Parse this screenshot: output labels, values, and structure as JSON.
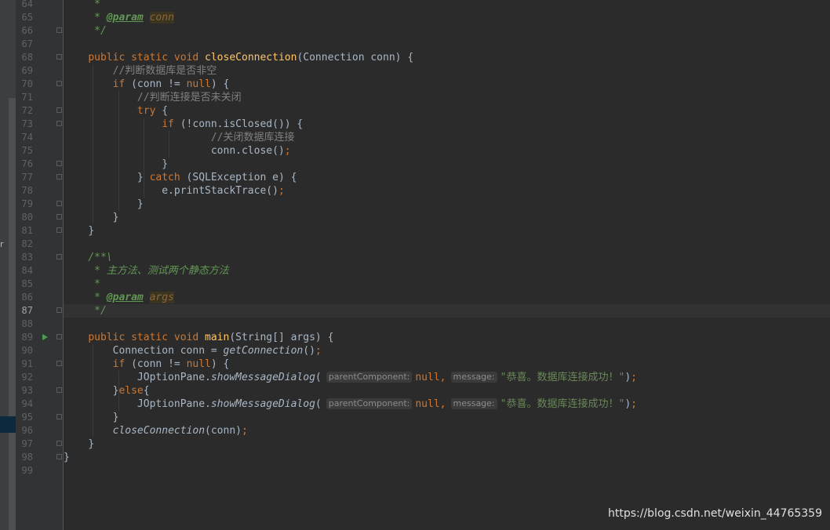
{
  "side_panel": {
    "glyph": "r"
  },
  "editor": {
    "run_gutter_line": "89",
    "current_line": "87",
    "lines": [
      {
        "num": "64",
        "fold": false,
        "segments": [
          {
            "t": "     ",
            "c": ""
          },
          {
            "t": "*",
            "c": "doc"
          }
        ]
      },
      {
        "num": "65",
        "fold": false,
        "segments": [
          {
            "t": "     ",
            "c": ""
          },
          {
            "t": "* ",
            "c": "doc"
          },
          {
            "t": "@param",
            "c": "tag"
          },
          {
            "t": " ",
            "c": "doc"
          },
          {
            "t": "conn",
            "c": "tagval"
          }
        ]
      },
      {
        "num": "66",
        "fold": true,
        "segments": [
          {
            "t": "     ",
            "c": ""
          },
          {
            "t": "*/",
            "c": "doc"
          }
        ]
      },
      {
        "num": "67",
        "fold": false,
        "segments": []
      },
      {
        "num": "68",
        "fold": true,
        "segments": [
          {
            "t": "    ",
            "c": ""
          },
          {
            "t": "public static void ",
            "c": "kw"
          },
          {
            "t": "closeConnection",
            "c": "fn"
          },
          {
            "t": "(Connection conn) {",
            "c": ""
          }
        ]
      },
      {
        "num": "69",
        "fold": false,
        "segments": [
          {
            "t": "        ",
            "c": ""
          },
          {
            "t": "//判断数据库是否非空",
            "c": "cm"
          }
        ]
      },
      {
        "num": "70",
        "fold": true,
        "segments": [
          {
            "t": "        ",
            "c": ""
          },
          {
            "t": "if ",
            "c": "kw"
          },
          {
            "t": "(conn != ",
            "c": ""
          },
          {
            "t": "null",
            "c": "kw"
          },
          {
            "t": ") {",
            "c": ""
          }
        ]
      },
      {
        "num": "71",
        "fold": false,
        "segments": [
          {
            "t": "            ",
            "c": ""
          },
          {
            "t": "//判断连接是否未关闭",
            "c": "cm"
          }
        ]
      },
      {
        "num": "72",
        "fold": true,
        "segments": [
          {
            "t": "            ",
            "c": ""
          },
          {
            "t": "try ",
            "c": "kw"
          },
          {
            "t": "{",
            "c": ""
          }
        ]
      },
      {
        "num": "73",
        "fold": true,
        "segments": [
          {
            "t": "                ",
            "c": ""
          },
          {
            "t": "if ",
            "c": "kw"
          },
          {
            "t": "(!conn.isClosed()) {",
            "c": ""
          }
        ]
      },
      {
        "num": "74",
        "fold": false,
        "segments": [
          {
            "t": "                        ",
            "c": ""
          },
          {
            "t": "//关闭数据库连接",
            "c": "cm"
          }
        ]
      },
      {
        "num": "75",
        "fold": false,
        "segments": [
          {
            "t": "                        ",
            "c": ""
          },
          {
            "t": "conn.close()",
            "c": ""
          },
          {
            "t": ";",
            "c": "kw"
          }
        ]
      },
      {
        "num": "76",
        "fold": true,
        "segments": [
          {
            "t": "                ",
            "c": ""
          },
          {
            "t": "}",
            "c": ""
          }
        ]
      },
      {
        "num": "77",
        "fold": true,
        "segments": [
          {
            "t": "            ",
            "c": ""
          },
          {
            "t": "} ",
            "c": ""
          },
          {
            "t": "catch ",
            "c": "kw"
          },
          {
            "t": "(SQLException e) {",
            "c": ""
          }
        ]
      },
      {
        "num": "78",
        "fold": false,
        "segments": [
          {
            "t": "                ",
            "c": ""
          },
          {
            "t": "e.printStackTrace()",
            "c": ""
          },
          {
            "t": ";",
            "c": "kw"
          }
        ]
      },
      {
        "num": "79",
        "fold": true,
        "segments": [
          {
            "t": "            ",
            "c": ""
          },
          {
            "t": "}",
            "c": ""
          }
        ]
      },
      {
        "num": "80",
        "fold": true,
        "segments": [
          {
            "t": "        ",
            "c": ""
          },
          {
            "t": "}",
            "c": ""
          }
        ]
      },
      {
        "num": "81",
        "fold": true,
        "segments": [
          {
            "t": "    ",
            "c": ""
          },
          {
            "t": "}",
            "c": ""
          }
        ]
      },
      {
        "num": "82",
        "fold": false,
        "segments": []
      },
      {
        "num": "83",
        "fold": true,
        "segments": [
          {
            "t": "    ",
            "c": ""
          },
          {
            "t": "/**\\",
            "c": "doc"
          }
        ]
      },
      {
        "num": "84",
        "fold": false,
        "segments": [
          {
            "t": "     ",
            "c": ""
          },
          {
            "t": "* 主方法、测试两个静态方法",
            "c": "doc"
          }
        ]
      },
      {
        "num": "85",
        "fold": false,
        "segments": [
          {
            "t": "     ",
            "c": ""
          },
          {
            "t": "*",
            "c": "doc"
          }
        ]
      },
      {
        "num": "86",
        "fold": false,
        "segments": [
          {
            "t": "     ",
            "c": ""
          },
          {
            "t": "* ",
            "c": "doc"
          },
          {
            "t": "@param",
            "c": "tag"
          },
          {
            "t": " ",
            "c": "doc"
          },
          {
            "t": "args",
            "c": "tagval"
          }
        ]
      },
      {
        "num": "87",
        "fold": true,
        "segments": [
          {
            "t": "     ",
            "c": ""
          },
          {
            "t": "*/",
            "c": "doc"
          }
        ]
      },
      {
        "num": "88",
        "fold": false,
        "segments": []
      },
      {
        "num": "89",
        "fold": true,
        "segments": [
          {
            "t": "    ",
            "c": ""
          },
          {
            "t": "public static void ",
            "c": "kw"
          },
          {
            "t": "main",
            "c": "fn"
          },
          {
            "t": "(String[] args) {",
            "c": ""
          }
        ]
      },
      {
        "num": "90",
        "fold": false,
        "segments": [
          {
            "t": "        ",
            "c": ""
          },
          {
            "t": "Connection conn = ",
            "c": ""
          },
          {
            "t": "getConnection",
            "c": "it"
          },
          {
            "t": "()",
            "c": ""
          },
          {
            "t": ";",
            "c": "kw"
          }
        ]
      },
      {
        "num": "91",
        "fold": true,
        "segments": [
          {
            "t": "        ",
            "c": ""
          },
          {
            "t": "if ",
            "c": "kw"
          },
          {
            "t": "(conn != ",
            "c": ""
          },
          {
            "t": "null",
            "c": "kw"
          },
          {
            "t": ") {",
            "c": ""
          }
        ]
      },
      {
        "num": "92",
        "fold": false,
        "segments": [
          {
            "t": "            ",
            "c": ""
          },
          {
            "t": "JOptionPane.",
            "c": ""
          },
          {
            "t": "showMessageDialog",
            "c": "it"
          },
          {
            "t": "(",
            "c": ""
          },
          {
            "t": "parentComponent:",
            "c": "hint"
          },
          {
            "t": "null",
            "c": "kw"
          },
          {
            "t": ",",
            "c": "kw"
          },
          {
            "t": "message:",
            "c": "hint"
          },
          {
            "t": "\"恭喜。数据库连接成功！\"",
            "c": "str"
          },
          {
            "t": ")",
            "c": ""
          },
          {
            "t": ";",
            "c": "kw"
          }
        ]
      },
      {
        "num": "93",
        "fold": true,
        "segments": [
          {
            "t": "        ",
            "c": ""
          },
          {
            "t": "}",
            "c": ""
          },
          {
            "t": "else",
            "c": "kw"
          },
          {
            "t": "{",
            "c": ""
          }
        ]
      },
      {
        "num": "94",
        "fold": false,
        "segments": [
          {
            "t": "            ",
            "c": ""
          },
          {
            "t": "JOptionPane.",
            "c": ""
          },
          {
            "t": "showMessageDialog",
            "c": "it"
          },
          {
            "t": "(",
            "c": ""
          },
          {
            "t": "parentComponent:",
            "c": "hint"
          },
          {
            "t": "null",
            "c": "kw"
          },
          {
            "t": ",",
            "c": "kw"
          },
          {
            "t": "message:",
            "c": "hint"
          },
          {
            "t": "\"恭喜。数据库连接成功！\"",
            "c": "str"
          },
          {
            "t": ")",
            "c": ""
          },
          {
            "t": ";",
            "c": "kw"
          }
        ]
      },
      {
        "num": "95",
        "fold": true,
        "segments": [
          {
            "t": "        ",
            "c": ""
          },
          {
            "t": "}",
            "c": ""
          }
        ]
      },
      {
        "num": "96",
        "fold": false,
        "segments": [
          {
            "t": "        ",
            "c": ""
          },
          {
            "t": "closeConnection",
            "c": "it"
          },
          {
            "t": "(conn)",
            "c": ""
          },
          {
            "t": ";",
            "c": "kw"
          }
        ]
      },
      {
        "num": "97",
        "fold": true,
        "segments": [
          {
            "t": "    ",
            "c": ""
          },
          {
            "t": "}",
            "c": ""
          }
        ]
      },
      {
        "num": "98",
        "fold": true,
        "segments": [
          {
            "t": "",
            "c": ""
          },
          {
            "t": "}",
            "c": ""
          }
        ]
      },
      {
        "num": "99",
        "fold": false,
        "segments": []
      }
    ]
  },
  "watermark": "https://blog.csdn.net/weixin_44765359",
  "colors": {
    "background": "#2b2b2b",
    "gutter": "#313335",
    "keyword": "#cc7832",
    "method": "#ffc66d",
    "comment": "#808080",
    "javadoc": "#629755",
    "string": "#6a8759",
    "text": "#a9b7c6"
  }
}
